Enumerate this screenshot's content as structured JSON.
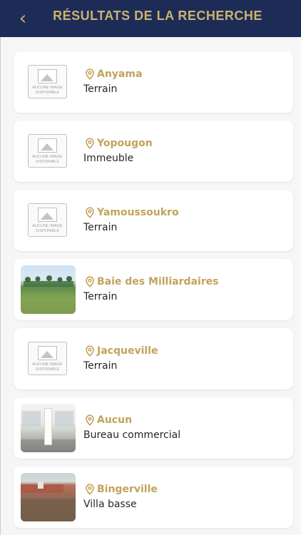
{
  "header": {
    "title": "RÉSULTATS DE LA RECHERCHE",
    "back_glyph": "‹"
  },
  "placeholder_text": "AUCUNE IMAGE DISPONIBLE",
  "results": [
    {
      "city": "Anyama",
      "type": "Terrain",
      "image": "none"
    },
    {
      "city": "Yopougon",
      "type": "Immeuble",
      "image": "none"
    },
    {
      "city": "Yamoussoukro",
      "type": "Terrain",
      "image": "none"
    },
    {
      "city": "Baie des Milliardaires",
      "type": "Terrain",
      "image": "beach-land-photo"
    },
    {
      "city": "Jacqueville",
      "type": "Terrain",
      "image": "none"
    },
    {
      "city": "Aucun",
      "type": "Bureau commercial",
      "image": "office-interior-photo"
    },
    {
      "city": "Bingerville",
      "type": "Villa basse",
      "image": "villa-lot-photo"
    }
  ],
  "colors": {
    "header_bg": "#1d2c57",
    "accent_gold": "#c1a35c",
    "card_bg": "#ffffff",
    "page_bg": "#f6f6f7"
  }
}
